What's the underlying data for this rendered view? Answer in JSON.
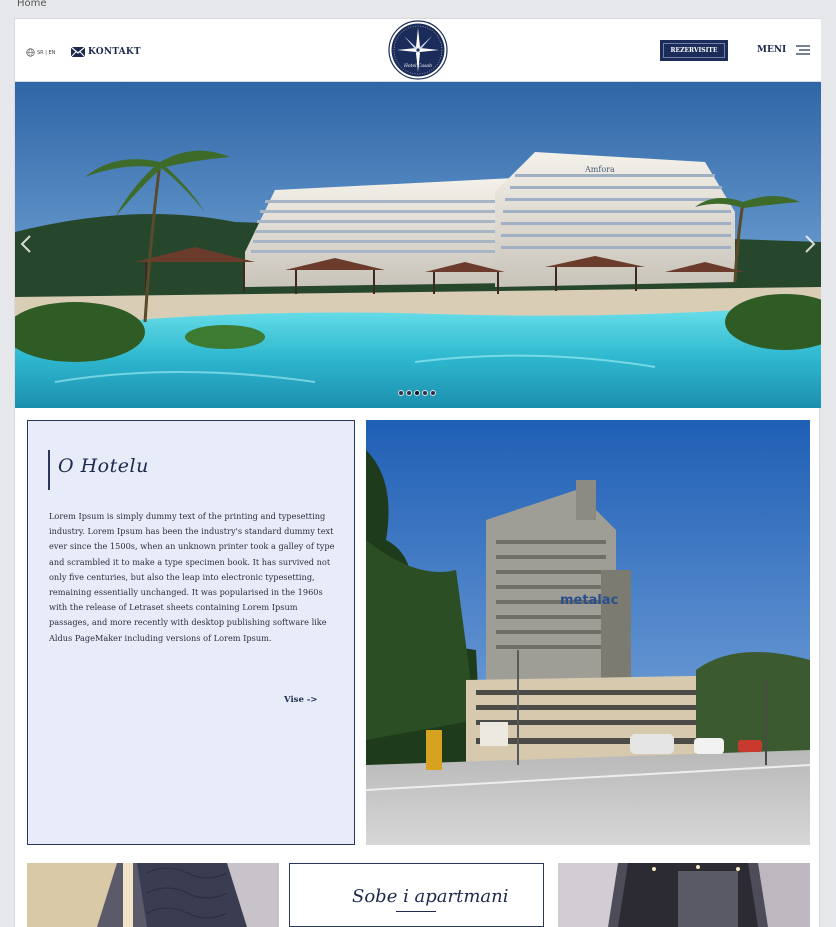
{
  "breadcrumb": "Home",
  "header": {
    "language": "SR | EN",
    "contact_label": "KONTAKT",
    "logo_text": "Hotel Casab",
    "reserve_label": "REZERVISITE",
    "menu_label": "MENI"
  },
  "hero": {
    "slide_count": 5,
    "active_slide": 3,
    "sign_text": "Amfora"
  },
  "about": {
    "title": "O Hotelu",
    "text": "Lorem Ipsum is simply dummy text of the printing and typesetting industry. Lorem Ipsum has been the industry's standard dummy text ever since the 1500s, when an unknown printer took a galley of type and scrambled it to make a type specimen book. It has survived not only five centuries, but also the leap into electronic typesetting, remaining essentially unchanged. It was popularised in the 1960s with the release of Letraset sheets containing Lorem Ipsum passages, and more recently with desktop publishing software like Aldus PageMaker including versions of Lorem Ipsum.",
    "more_label": "Vise ->",
    "sign_text": "metalac"
  },
  "rooms": {
    "title": "Sobe i apartmani"
  },
  "colors": {
    "navy": "#1b2c5a",
    "panel": "#e8ecf8",
    "pool": "#3ec3d6"
  },
  "icons": {
    "contact": "envelope-icon",
    "language": "globe-icon",
    "menu": "hamburger-icon",
    "prev": "chevron-left-icon",
    "next": "chevron-right-icon"
  }
}
